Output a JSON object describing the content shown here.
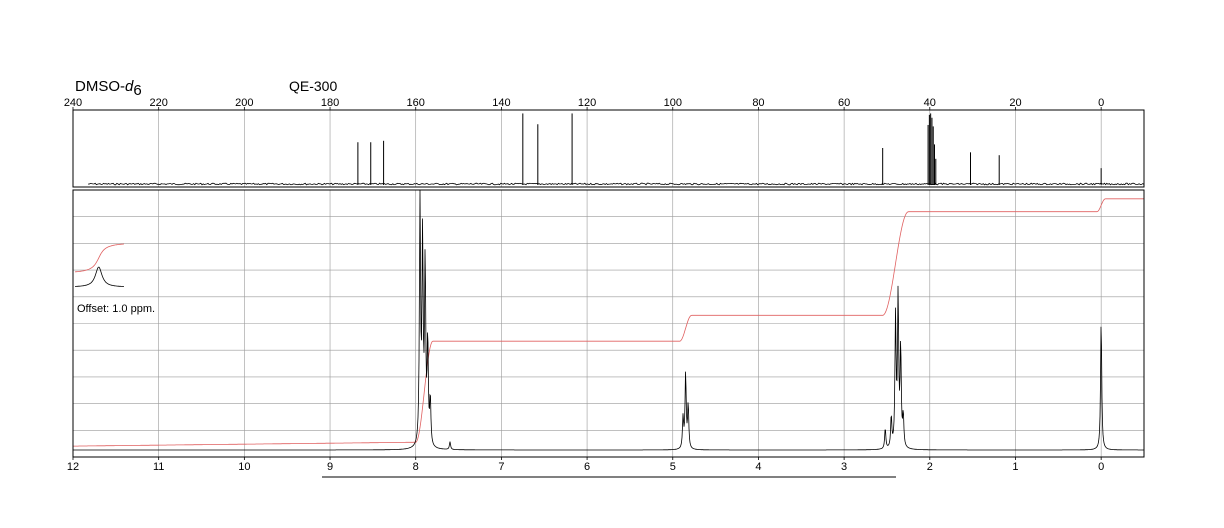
{
  "header": {
    "solvent_base": "DMSO-",
    "solvent_italic": "d",
    "solvent_sub": "6",
    "instrument": "QE-300"
  },
  "offset_label": "Offset: 1.0 ppm.",
  "colors": {
    "spectrum": "#000000",
    "integral": "#e06060",
    "grid": "#9a9a9a"
  },
  "chart_data": [
    {
      "type": "line",
      "name": "13C NMR spectrum",
      "xlim": [
        240,
        -10
      ],
      "x_ticks": [
        240,
        220,
        200,
        180,
        160,
        140,
        120,
        100,
        80,
        60,
        40,
        20,
        0
      ],
      "ylim": [
        0,
        1
      ],
      "grid": true,
      "peaks": [
        {
          "x": 173.5,
          "y": 0.58
        },
        {
          "x": 170.5,
          "y": 0.58
        },
        {
          "x": 167.5,
          "y": 0.6
        },
        {
          "x": 135.0,
          "y": 0.98
        },
        {
          "x": 131.5,
          "y": 0.83
        },
        {
          "x": 123.5,
          "y": 0.98
        },
        {
          "x": 51.0,
          "y": 0.5
        },
        {
          "x": 40.4,
          "y": 0.82
        },
        {
          "x": 40.1,
          "y": 0.96
        },
        {
          "x": 39.8,
          "y": 0.98
        },
        {
          "x": 39.5,
          "y": 0.92
        },
        {
          "x": 39.2,
          "y": 0.8
        },
        {
          "x": 38.9,
          "y": 0.55
        },
        {
          "x": 38.6,
          "y": 0.35
        },
        {
          "x": 30.5,
          "y": 0.44
        },
        {
          "x": 23.8,
          "y": 0.4
        },
        {
          "x": 0.0,
          "y": 0.22
        }
      ]
    },
    {
      "type": "line",
      "name": "1H NMR spectrum",
      "xlim": [
        12,
        -0.5
      ],
      "x_ticks": [
        12,
        11,
        10,
        9,
        8,
        7,
        6,
        5,
        4,
        3,
        2,
        1,
        0
      ],
      "ylim": [
        0,
        1
      ],
      "grid": true,
      "peaks": [
        {
          "x": 7.95,
          "y": 0.96
        },
        {
          "x": 7.92,
          "y": 0.78
        },
        {
          "x": 7.89,
          "y": 0.7
        },
        {
          "x": 7.86,
          "y": 0.4
        },
        {
          "x": 7.83,
          "y": 0.18
        },
        {
          "x": 7.6,
          "y": 0.03
        },
        {
          "x": 4.88,
          "y": 0.12
        },
        {
          "x": 4.85,
          "y": 0.29
        },
        {
          "x": 4.82,
          "y": 0.17
        },
        {
          "x": 2.52,
          "y": 0.08
        },
        {
          "x": 2.45,
          "y": 0.12
        },
        {
          "x": 2.4,
          "y": 0.5
        },
        {
          "x": 2.37,
          "y": 0.58
        },
        {
          "x": 2.34,
          "y": 0.38
        },
        {
          "x": 2.31,
          "y": 0.12
        },
        {
          "x": 0.0,
          "y": 0.5
        }
      ],
      "integral_steps": [
        {
          "start": 8.0,
          "end": 7.8,
          "level_before": 0.03,
          "level_after": 0.42
        },
        {
          "start": 4.92,
          "end": 4.78,
          "level_before": 0.42,
          "level_after": 0.52
        },
        {
          "start": 2.55,
          "end": 2.25,
          "level_before": 0.52,
          "level_after": 0.92
        },
        {
          "start": 0.05,
          "end": -0.05,
          "level_before": 0.92,
          "level_after": 0.97
        }
      ],
      "offset_ppm": 1.0,
      "inset": {
        "x": 11.7,
        "note": "offset peak region"
      }
    }
  ]
}
